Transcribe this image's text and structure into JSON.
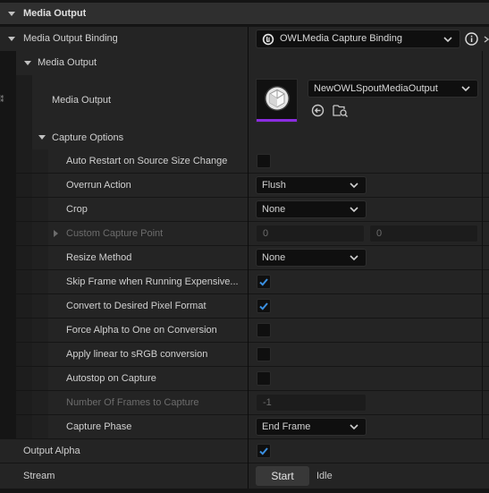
{
  "header": {
    "title": "Media Output"
  },
  "binding": {
    "label": "Media Output Binding",
    "value": "OWLMedia Capture Binding"
  },
  "media_output_group": {
    "label": "Media Output",
    "property_label": "Media Output",
    "asset_name": "NewOWLSpoutMediaOutput"
  },
  "capture_options": {
    "label": "Capture Options",
    "auto_restart": {
      "label": "Auto Restart on Source Size Change",
      "checked": false
    },
    "overrun_action": {
      "label": "Overrun Action",
      "value": "Flush"
    },
    "crop": {
      "label": "Crop",
      "value": "None"
    },
    "custom_capture_point": {
      "label": "Custom Capture Point",
      "x": "0",
      "y": "0"
    },
    "resize_method": {
      "label": "Resize Method",
      "value": "None"
    },
    "skip_frame": {
      "label": "Skip Frame when Running Expensive...",
      "checked": true
    },
    "convert_pixel": {
      "label": "Convert to Desired Pixel Format",
      "checked": true
    },
    "force_alpha": {
      "label": "Force Alpha to One on Conversion",
      "checked": false
    },
    "apply_linear": {
      "label": "Apply linear to sRGB conversion",
      "checked": false
    },
    "autostop": {
      "label": "Autostop on Capture",
      "checked": false
    },
    "num_frames": {
      "label": "Number Of Frames to Capture",
      "value": "-1"
    },
    "capture_phase": {
      "label": "Capture Phase",
      "value": "End Frame"
    }
  },
  "output_alpha": {
    "label": "Output Alpha",
    "checked": true
  },
  "stream": {
    "label": "Stream",
    "button_label": "Start",
    "status": "Idle"
  },
  "icons": {
    "expand": "chevron-down-icon",
    "asset_thumbnail": "cube-icon",
    "info": "info-icon",
    "use_selected": "arrow-left-circle-icon",
    "browse": "folder-search-icon"
  },
  "colors": {
    "panel_bg": "#242424",
    "header_bg": "#2f2f2f",
    "check_blue": "#3a8fe0",
    "thumb_underline": "#8b2ce0"
  }
}
